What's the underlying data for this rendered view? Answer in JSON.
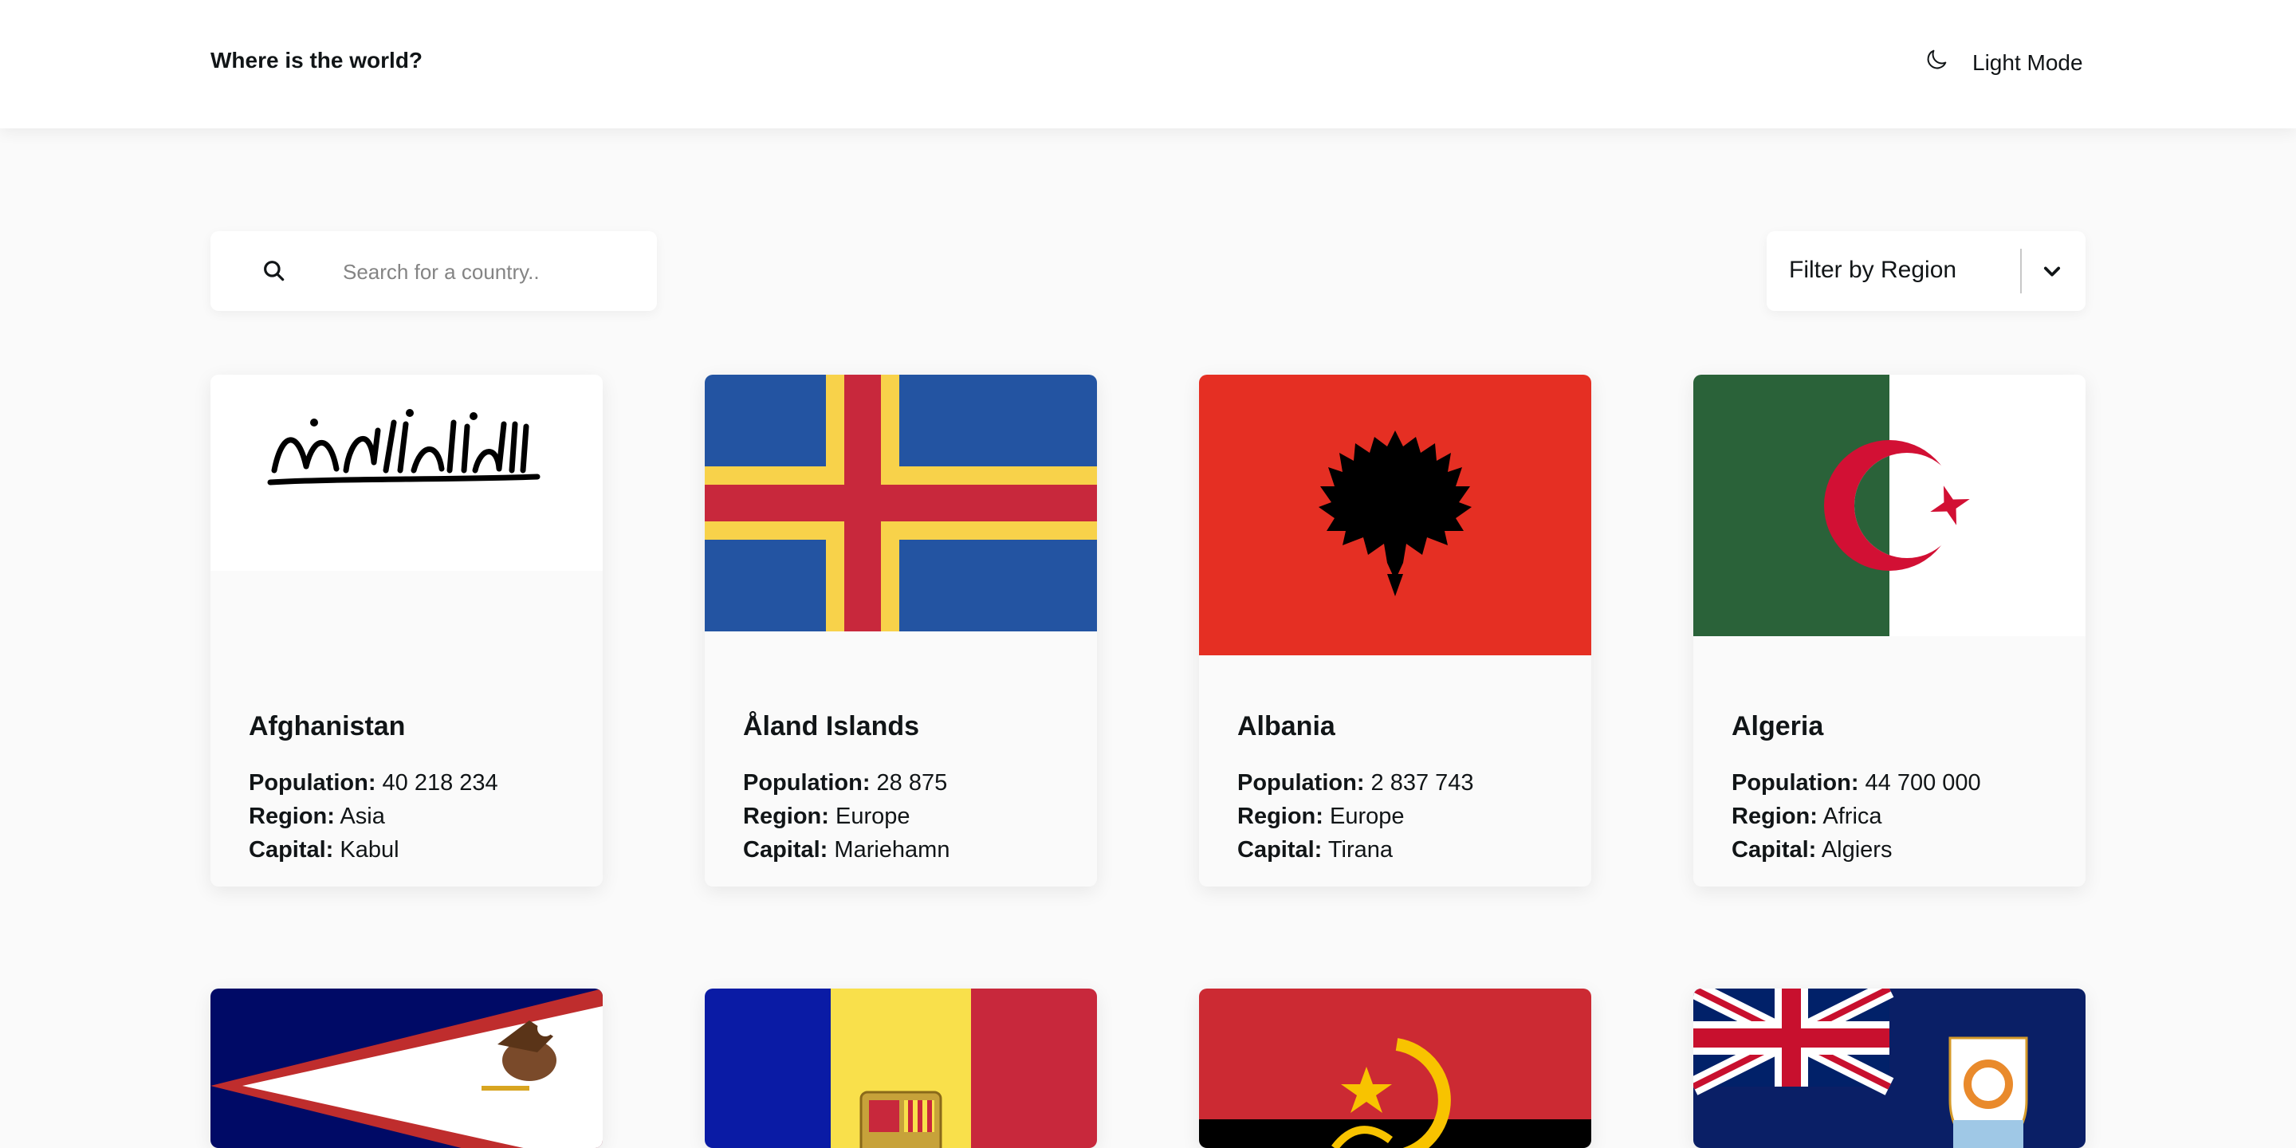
{
  "header": {
    "brand": "Where is the world?",
    "mode_label": "Light Mode",
    "mode_icon": "moon-icon"
  },
  "search": {
    "placeholder": "Search for a country..",
    "icon": "search-icon"
  },
  "filter": {
    "label": "Filter by Region",
    "icon": "chevron-down-icon"
  },
  "labels": {
    "population": "Population:",
    "region": "Region:",
    "capital": "Capital:"
  },
  "countries": [
    {
      "name": "Afghanistan",
      "population": "40 218 234",
      "region": "Asia",
      "capital": "Kabul"
    },
    {
      "name": "Åland Islands",
      "population": "28 875",
      "region": "Europe",
      "capital": "Mariehamn"
    },
    {
      "name": "Albania",
      "population": "2 837 743",
      "region": "Europe",
      "capital": "Tirana"
    },
    {
      "name": "Algeria",
      "population": "44 700 000",
      "region": "Africa",
      "capital": "Algiers"
    }
  ],
  "flag_colors": {
    "aland_blue": "#2354a2",
    "aland_yellow": "#f8d24a",
    "aland_red": "#c8283c",
    "albania_red": "#e52f23",
    "algeria_green": "#2a6239",
    "algeria_red": "#d21034",
    "samoa_blue": "#000a66",
    "samoa_red": "#bf2d2d",
    "andorra_blue": "#0a1ba5",
    "andorra_yellow": "#f9e04b",
    "andorra_red": "#c8283c",
    "angola_red": "#cc2a33",
    "anguilla_blue": "#0a1f66"
  }
}
